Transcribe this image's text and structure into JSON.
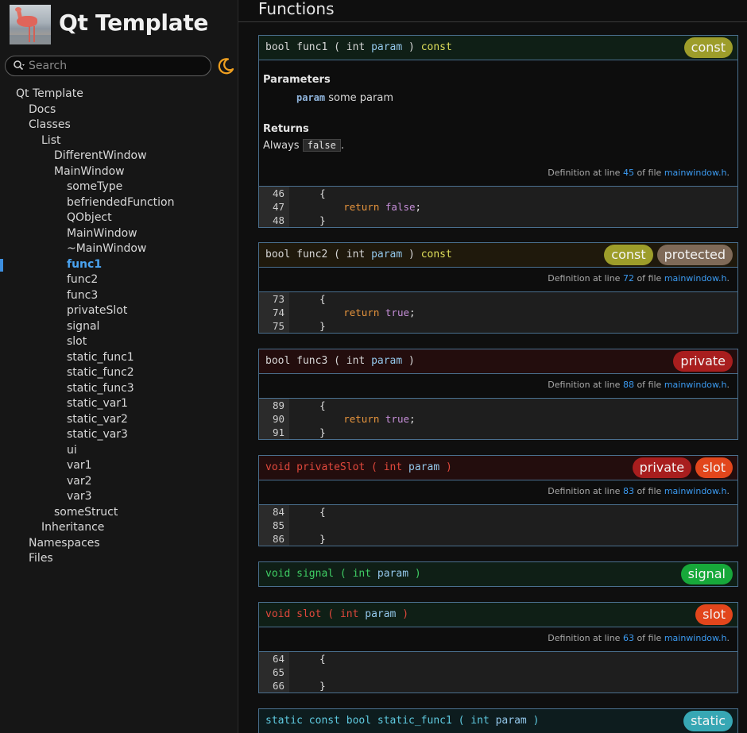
{
  "sidebar": {
    "title": "Qt Template",
    "search_placeholder": "Search",
    "nav": [
      {
        "label": "Qt Template",
        "indent": 0
      },
      {
        "label": "Docs",
        "indent": 1
      },
      {
        "label": "Classes",
        "indent": 1
      },
      {
        "label": "List",
        "indent": 2
      },
      {
        "label": "DifferentWindow",
        "indent": 3
      },
      {
        "label": "MainWindow",
        "indent": 3
      },
      {
        "label": "someType",
        "indent": 4
      },
      {
        "label": "befriendedFunction",
        "indent": 4
      },
      {
        "label": "QObject",
        "indent": 4
      },
      {
        "label": "MainWindow",
        "indent": 4
      },
      {
        "label": "~MainWindow",
        "indent": 4
      },
      {
        "label": "func1",
        "indent": 4,
        "selected": true
      },
      {
        "label": "func2",
        "indent": 4
      },
      {
        "label": "func3",
        "indent": 4
      },
      {
        "label": "privateSlot",
        "indent": 4
      },
      {
        "label": "signal",
        "indent": 4
      },
      {
        "label": "slot",
        "indent": 4
      },
      {
        "label": "static_func1",
        "indent": 4
      },
      {
        "label": "static_func2",
        "indent": 4
      },
      {
        "label": "static_func3",
        "indent": 4
      },
      {
        "label": "static_var1",
        "indent": 4
      },
      {
        "label": "static_var2",
        "indent": 4
      },
      {
        "label": "static_var3",
        "indent": 4
      },
      {
        "label": "ui",
        "indent": 4
      },
      {
        "label": "var1",
        "indent": 4
      },
      {
        "label": "var2",
        "indent": 4
      },
      {
        "label": "var3",
        "indent": 4
      },
      {
        "label": "someStruct",
        "indent": 3
      },
      {
        "label": "Inheritance",
        "indent": 2
      },
      {
        "label": "Namespaces",
        "indent": 1
      },
      {
        "label": "Files",
        "indent": 1
      }
    ]
  },
  "main": {
    "section_title": "Functions",
    "def_prefix": "Definition at line",
    "def_of_file": "of file",
    "def_file": "mainwindow.h",
    "def_suffix": ".",
    "members": [
      {
        "ret": "bool",
        "name": "func1",
        "ptype": "int",
        "pname": "param",
        "qualifier": "const",
        "badges": [
          "const"
        ],
        "style": "green",
        "parameters_heading": "Parameters",
        "param_name": "param",
        "param_desc": "some param",
        "returns_heading": "Returns",
        "returns_prefix": "Always",
        "returns_code": "false",
        "returns_suffix": ".",
        "def_line": "45",
        "code": [
          {
            "n": "46",
            "t": "    {"
          },
          {
            "n": "47",
            "t": "        return false;"
          },
          {
            "n": "48",
            "t": "    }"
          }
        ]
      },
      {
        "ret": "bool",
        "name": "func2",
        "ptype": "int",
        "pname": "param",
        "qualifier": "const",
        "badges": [
          "const",
          "protected"
        ],
        "style": "amber",
        "def_line": "72",
        "code": [
          {
            "n": "73",
            "t": "    {"
          },
          {
            "n": "74",
            "t": "        return true;"
          },
          {
            "n": "75",
            "t": "    }"
          }
        ]
      },
      {
        "ret": "bool",
        "name": "func3",
        "ptype": "int",
        "pname": "param",
        "qualifier": "",
        "badges": [
          "private"
        ],
        "style": "red",
        "def_line": "88",
        "code": [
          {
            "n": "89",
            "t": "    {"
          },
          {
            "n": "90",
            "t": "        return true;"
          },
          {
            "n": "91",
            "t": "    }"
          }
        ]
      },
      {
        "ret": "void",
        "name": "privateSlot",
        "ptype": "int",
        "pname": "param",
        "qualifier": "",
        "badges": [
          "private",
          "slot"
        ],
        "style": "red",
        "def_line": "83",
        "code": [
          {
            "n": "84",
            "t": "    {"
          },
          {
            "n": "85",
            "t": ""
          },
          {
            "n": "86",
            "t": "    }"
          }
        ]
      },
      {
        "ret": "void",
        "name": "signal",
        "ptype": "int",
        "pname": "param",
        "qualifier": "",
        "badges": [
          "signal"
        ],
        "style": "green"
      },
      {
        "ret": "void",
        "name": "slot",
        "ptype": "int",
        "pname": "param",
        "qualifier": "",
        "badges": [
          "slot"
        ],
        "style": "green",
        "def_line": "63",
        "code": [
          {
            "n": "64",
            "t": "    {"
          },
          {
            "n": "65",
            "t": ""
          },
          {
            "n": "66",
            "t": "    }"
          }
        ]
      },
      {
        "ret": "static const bool",
        "name": "static_func1",
        "ptype": "int",
        "pname": "param",
        "qualifier": "",
        "badges": [
          "static"
        ],
        "style": "teal"
      }
    ]
  },
  "colors": {
    "accent": "#3d8fe0",
    "badge_const": "#9d9d2a",
    "badge_protected": "#7f6a58",
    "badge_private": "#a81e1e",
    "badge_slot": "#e2461c",
    "badge_signal": "#17a83a",
    "badge_static": "#37a7b4"
  },
  "icons": [
    "flamingo-logo",
    "search-icon",
    "moon-icon"
  ]
}
